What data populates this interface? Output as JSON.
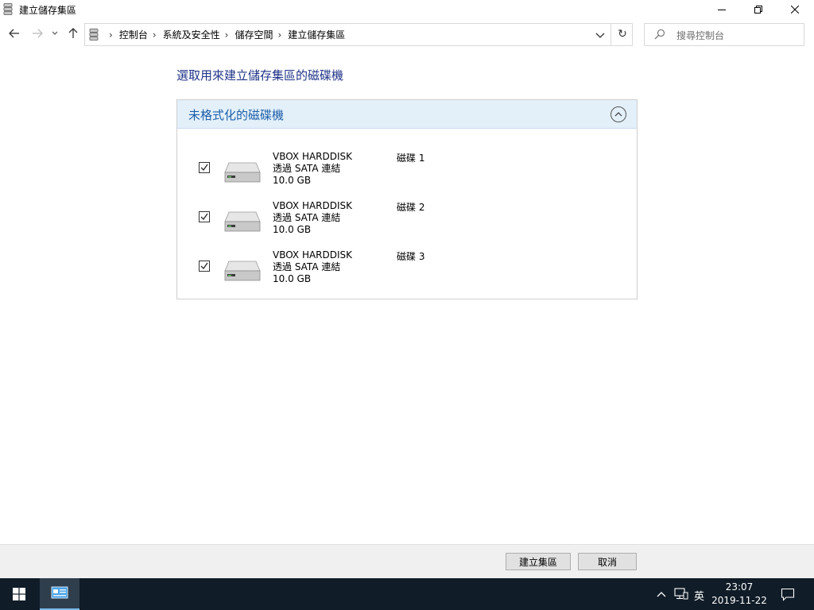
{
  "window": {
    "title": "建立儲存集區",
    "icon": "storage-spaces-icon"
  },
  "breadcrumb": {
    "items": [
      "控制台",
      "系統及安全性",
      "儲存空間",
      "建立儲存集區"
    ]
  },
  "search": {
    "placeholder": "搜尋控制台"
  },
  "main": {
    "heading": "選取用來建立儲存集區的磁碟機",
    "group_title": "未格式化的磁碟機",
    "disks": [
      {
        "checked": true,
        "name": "VBOX HARDDISK",
        "connection": "透過 SATA 連結",
        "size": "10.0 GB",
        "label": "磁碟 1"
      },
      {
        "checked": true,
        "name": "VBOX HARDDISK",
        "connection": "透過 SATA 連結",
        "size": "10.0 GB",
        "label": "磁碟 2"
      },
      {
        "checked": true,
        "name": "VBOX HARDDISK",
        "connection": "透過 SATA 連結",
        "size": "10.0 GB",
        "label": "磁碟 3"
      }
    ]
  },
  "footer": {
    "create_label": "建立集區",
    "cancel_label": "取消"
  },
  "taskbar": {
    "ime": "英",
    "time": "23:07",
    "date": "2019-11-22"
  },
  "colors": {
    "heading": "#1e3287",
    "group_header_bg": "#e3f0fa",
    "taskbar_bg": "#101c28"
  }
}
